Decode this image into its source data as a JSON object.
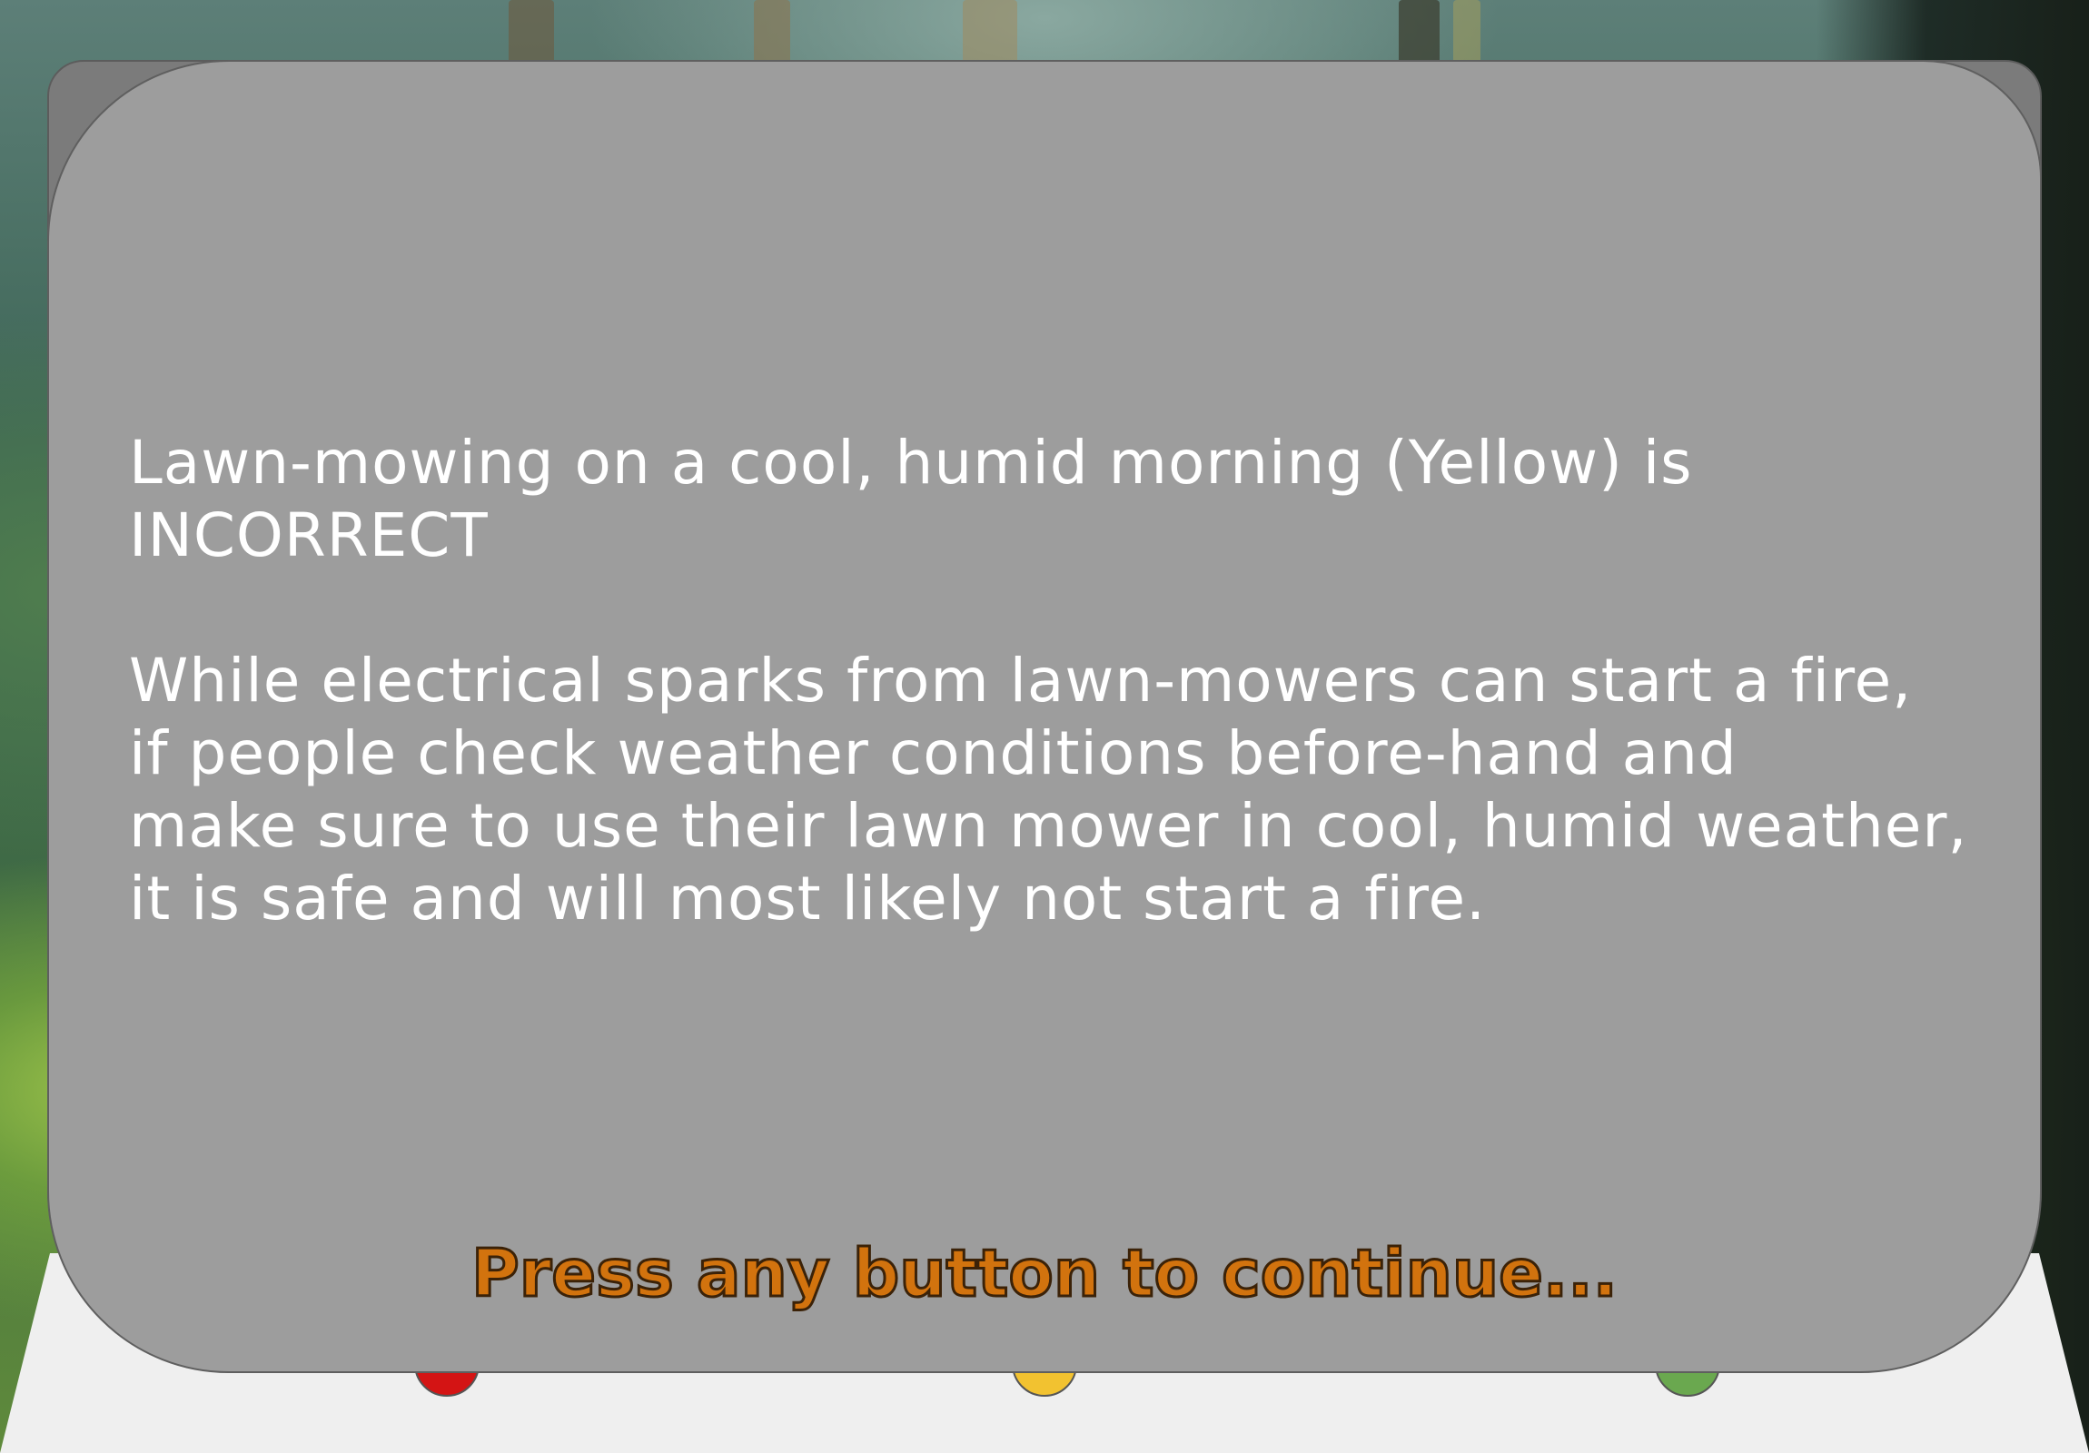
{
  "feedback": {
    "verdict_line_1": "Lawn-mowing on a cool, humid morning (Yellow) is",
    "verdict_line_2": "INCORRECT",
    "explanation_lines": [
      "While electrical sparks from lawn-mowers can start a fire,",
      "if people check weather conditions before-hand and",
      "make sure to use their lawn mower in cool, humid weather,",
      "it is safe and will most likely not start a fire."
    ]
  },
  "prompt": {
    "continue_text": "Press any button to continue..."
  },
  "colors": {
    "card": "#9d9d9d",
    "card_back": "#7b7b7b",
    "text": "#ffffff",
    "prompt_fill": "#d2730e",
    "prompt_outline": "#3b2208",
    "button_red": "#d41414",
    "button_yellow": "#f2c230",
    "button_green": "#6aa84f"
  },
  "buttons": [
    {
      "icon": "red-arcade-button"
    },
    {
      "icon": "yellow-arcade-button"
    },
    {
      "icon": "green-arcade-button"
    }
  ]
}
